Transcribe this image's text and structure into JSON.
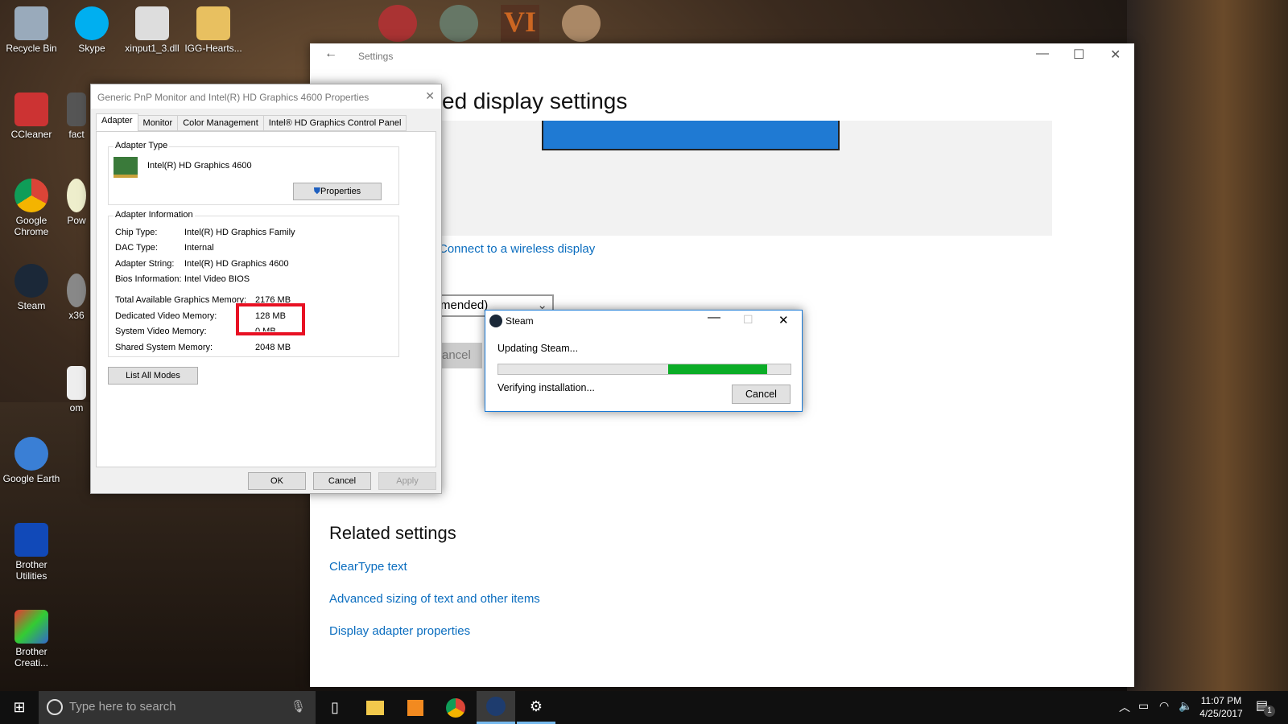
{
  "desktop": {
    "icons": [
      "Recycle Bin",
      "Skype",
      "xinput1_3.dll",
      "IGG-Hearts...",
      "CCleaner",
      "fact",
      "Google Chrome",
      "Pow",
      "Steam",
      "x36",
      "om",
      "Google Earth",
      "Brother Utilities",
      "Brother Creati..."
    ]
  },
  "settings": {
    "title": "Settings",
    "heading": "ed display settings",
    "wireless_link": "Connect to a wireless display",
    "dropdown_value": "mended)",
    "cancel_partial": "ancel",
    "related_heading": "Related settings",
    "related_links": [
      "ClearType text",
      "Advanced sizing of text and other items",
      "Display adapter properties"
    ]
  },
  "props": {
    "title": "Generic PnP Monitor and Intel(R) HD Graphics 4600 Properties",
    "tabs": [
      "Adapter",
      "Monitor",
      "Color Management",
      "Intel® HD Graphics Control Panel"
    ],
    "adapter_type_label": "Adapter Type",
    "adapter_name": "Intel(R) HD Graphics 4600",
    "properties_button": "Properties",
    "info_label": "Adapter Information",
    "info": [
      {
        "k": "Chip Type:",
        "v": "Intel(R) HD Graphics Family"
      },
      {
        "k": "DAC Type:",
        "v": "Internal"
      },
      {
        "k": "Adapter String:",
        "v": "Intel(R) HD Graphics 4600"
      },
      {
        "k": "Bios Information:",
        "v": "Intel Video BIOS"
      }
    ],
    "memory": [
      {
        "k": "Total Available Graphics Memory:",
        "v": "2176 MB"
      },
      {
        "k": "Dedicated Video Memory:",
        "v": "128 MB"
      },
      {
        "k": "System Video Memory:",
        "v": "0 MB"
      },
      {
        "k": "Shared System Memory:",
        "v": "2048 MB"
      }
    ],
    "list_modes": "List All Modes",
    "ok": "OK",
    "cancel": "Cancel",
    "apply": "Apply",
    "highlight_color": "#e81123"
  },
  "steam": {
    "title": "Steam",
    "status": "Updating Steam...",
    "detail": "Verifying installation...",
    "cancel": "Cancel",
    "progress_start": 0.58,
    "progress_end": 0.92,
    "bar_color": "#0bad27"
  },
  "taskbar": {
    "search_placeholder": "Type here to search",
    "time": "11:07 PM",
    "date": "4/25/2017",
    "notifications": "1"
  }
}
